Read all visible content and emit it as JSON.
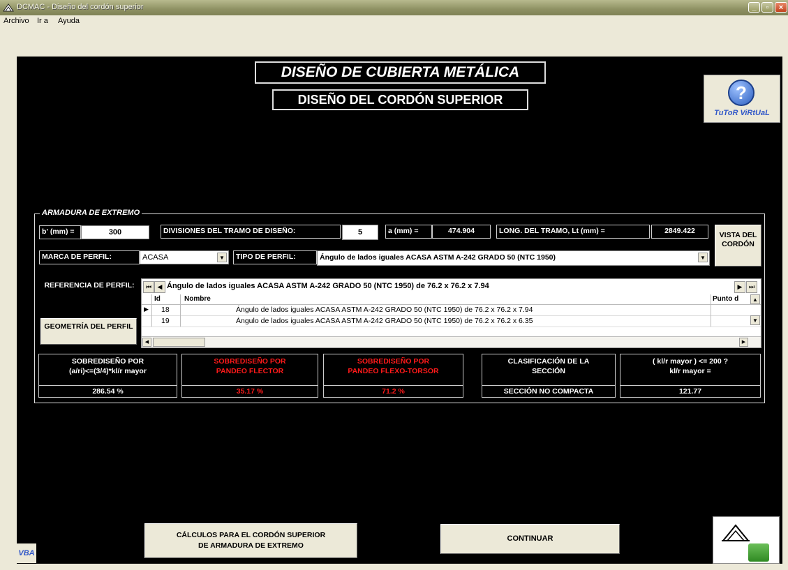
{
  "window": {
    "title": "DCMAC - Diseño del cordón superior",
    "minimize": "_",
    "maximize": "▫",
    "close": "×"
  },
  "menu": [
    "Archivo",
    "Ir a",
    "Ayuda"
  ],
  "header": {
    "title": "DISEÑO DE CUBIERTA METÁLICA",
    "subtitle": "DISEÑO DEL CORDÓN SUPERIOR"
  },
  "help": {
    "symbol": "?",
    "label": "TuToR ViRtUaL"
  },
  "frame": {
    "label": "ARMADURA DE EXTREMO",
    "b_label": "b' (mm) =",
    "b_value": "300",
    "div_label": "DIVISIONES DEL TRAMO DE DISEÑO:",
    "div_value": "5",
    "a_label": "a (mm) =",
    "a_value": "474.904",
    "lt_label": "LONG. DEL TRAMO, Lt (mm) =",
    "lt_value": "2849.422",
    "vista_button": "VISTA DEL CORDÓN",
    "marca_label": "MARCA DE PERFIL:",
    "marca_value": "ACASA",
    "tipo_label": "TIPO DE PERFIL:",
    "tipo_value": "Ángulo de lados iguales ACASA ASTM A-242 GRADO 50 (NTC 1950)",
    "ref_label": "REFERENCIA DE PERFIL:",
    "geom_button": "GEOMETRÍA DEL PERFIL",
    "nav_caption": "Ángulo de lados iguales ACASA ASTM A-242 GRADO 50 (NTC 1950) de 76.2 x 76.2 x 7.94",
    "grid": {
      "columns": [
        "Id",
        "Nombre",
        "Punto d"
      ],
      "rows": [
        {
          "id": "18",
          "nombre": "Ángulo de lados iguales ACASA ASTM A-242 GRADO 50 (NTC 1950) de 76.2 x 76.2 x 7.94"
        },
        {
          "id": "19",
          "nombre": "Ángulo de lados iguales ACASA ASTM A-242 GRADO 50 (NTC 1950) de 76.2 x 76.2 x 6.35"
        }
      ]
    },
    "results": [
      {
        "line1": "SOBREDISEÑO POR",
        "line2": "(a/ri)<=(3/4)*kl/r mayor",
        "value": "286.54 %",
        "alert": false
      },
      {
        "line1": "SOBREDISEÑO POR",
        "line2": "PANDEO FLECTOR",
        "value": "35.17 %",
        "alert": true
      },
      {
        "line1": "SOBREDISEÑO POR",
        "line2": "PANDEO FLEXO-TORSOR",
        "value": "71.2 %",
        "alert": true
      },
      {
        "line1": "CLASIFICACIÓN DE LA",
        "line2": "SECCIÓN",
        "value": "SECCIÓN NO COMPACTA",
        "alert": false
      },
      {
        "line1": "( kl/r mayor ) <= 200 ?",
        "line2": "kl/r mayor =",
        "value": "121.77",
        "alert": false
      }
    ]
  },
  "bottom": {
    "calc_button_line1": "CÁLCULOS PARA EL CORDÓN SUPERIOR",
    "calc_button_line2": "DE ARMADURA DE EXTREMO",
    "continue_button": "CONTINUAR",
    "vba_label": "VBA"
  }
}
